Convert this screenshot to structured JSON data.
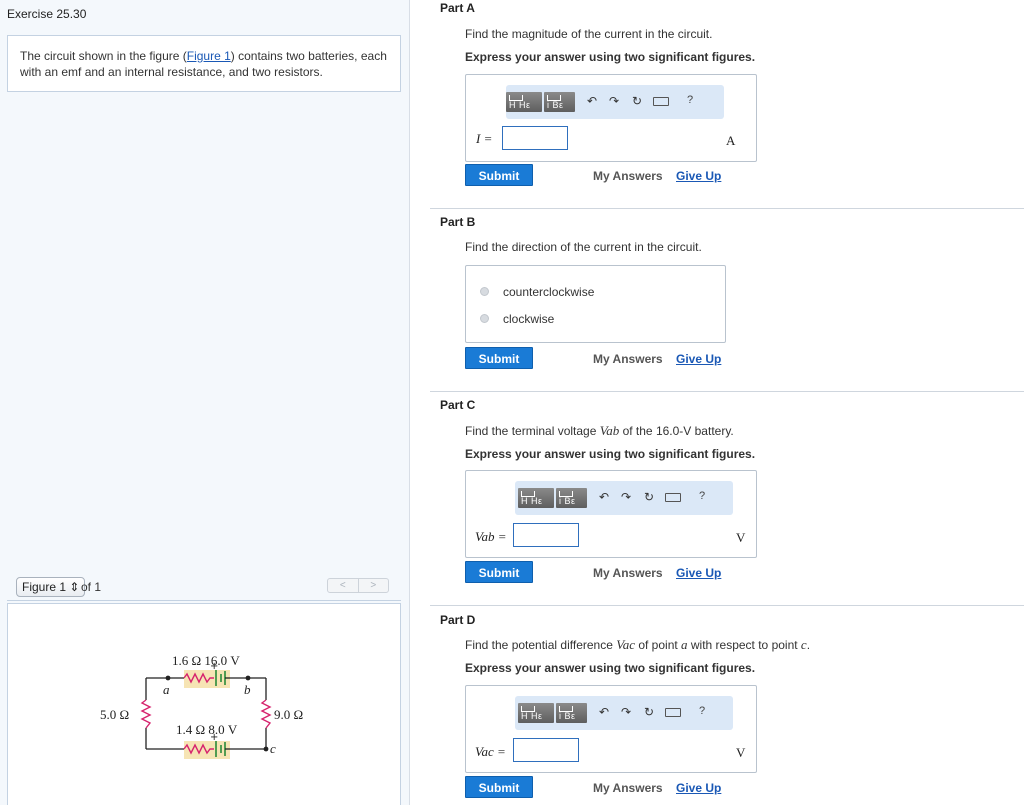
{
  "exercise_title": "Exercise 25.30",
  "problem": {
    "text_before": "The circuit shown in the figure (",
    "figure_link": "Figure 1",
    "text_after": ") contains two batteries, each with an emf and an internal resistance, and two resistors."
  },
  "figure_nav": {
    "select_value": "Figure 1",
    "of_text": "of 1",
    "prev": "<",
    "next": ">"
  },
  "circuit": {
    "top_labels": "1.6 Ω  16.0 V",
    "bottom_labels": "1.4 Ω  8.0 V",
    "left_resistor": "5.0 Ω",
    "right_resistor": "9.0 Ω",
    "point_a": "a",
    "point_b": "b",
    "point_c": "c"
  },
  "toolbar": {
    "templates_label": "H Hε",
    "subsup_label": "i Bε",
    "undo": "↶",
    "redo": "↷",
    "reset": "↻",
    "help": "?"
  },
  "common": {
    "submit": "Submit",
    "my_answers": "My Answers",
    "give_up": "Give Up",
    "sig_figs": "Express your answer using two significant figures."
  },
  "parts": {
    "a": {
      "title": "Part A",
      "question": "Find the magnitude of the current in the circuit.",
      "var": "I =",
      "unit": "A"
    },
    "b": {
      "title": "Part B",
      "question": "Find the direction of the current in the circuit.",
      "options": [
        "counterclockwise",
        "clockwise"
      ]
    },
    "c": {
      "title": "Part C",
      "question_pre": "Find the terminal voltage ",
      "question_var": "Vab",
      "question_post": " of the 16.0-V battery.",
      "var": "Vab =",
      "unit": "V"
    },
    "d": {
      "title": "Part D",
      "question_pre": "Find the potential difference ",
      "question_var": "Vac",
      "question_mid": " of point ",
      "point_a": "a",
      "question_mid2": " with respect to point ",
      "point_c": "c",
      "question_end": ".",
      "var": "Vac =",
      "unit": "V"
    }
  }
}
